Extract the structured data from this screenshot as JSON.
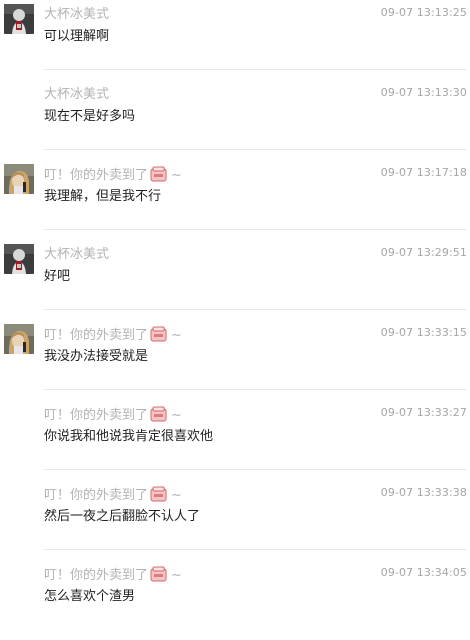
{
  "messages": [
    {
      "name": "大杯冰美式",
      "sticker": false,
      "time": "09-07 13:13:25",
      "text": "可以理解啊",
      "avatar": "avatar-dark"
    },
    {
      "name": "大杯冰美式",
      "sticker": false,
      "time": "09-07 13:13:30",
      "text": "现在不是好多吗",
      "avatar": "none"
    },
    {
      "name": "叮！你的外卖到了",
      "sticker": true,
      "suffix": "~",
      "time": "09-07 13:17:18",
      "text": "我理解，但是我不行",
      "avatar": "avatar-girl"
    },
    {
      "name": "大杯冰美式",
      "sticker": false,
      "time": "09-07 13:29:51",
      "text": "好吧",
      "avatar": "avatar-dark"
    },
    {
      "name": "叮！你的外卖到了",
      "sticker": true,
      "suffix": "~",
      "time": "09-07 13:33:15",
      "text": "我没办法接受就是",
      "avatar": "avatar-girl"
    },
    {
      "name": "叮！你的外卖到了",
      "sticker": true,
      "suffix": "~",
      "time": "09-07 13:33:27",
      "text": "你说我和他说我肯定很喜欢他",
      "avatar": "none"
    },
    {
      "name": "叮！你的外卖到了",
      "sticker": true,
      "suffix": "~",
      "time": "09-07 13:33:38",
      "text": "然后一夜之后翻脸不认人了",
      "avatar": "none"
    },
    {
      "name": "叮！你的外卖到了",
      "sticker": true,
      "suffix": "~",
      "time": "09-07 13:34:05",
      "text": "怎么喜欢个渣男",
      "avatar": "none"
    }
  ]
}
